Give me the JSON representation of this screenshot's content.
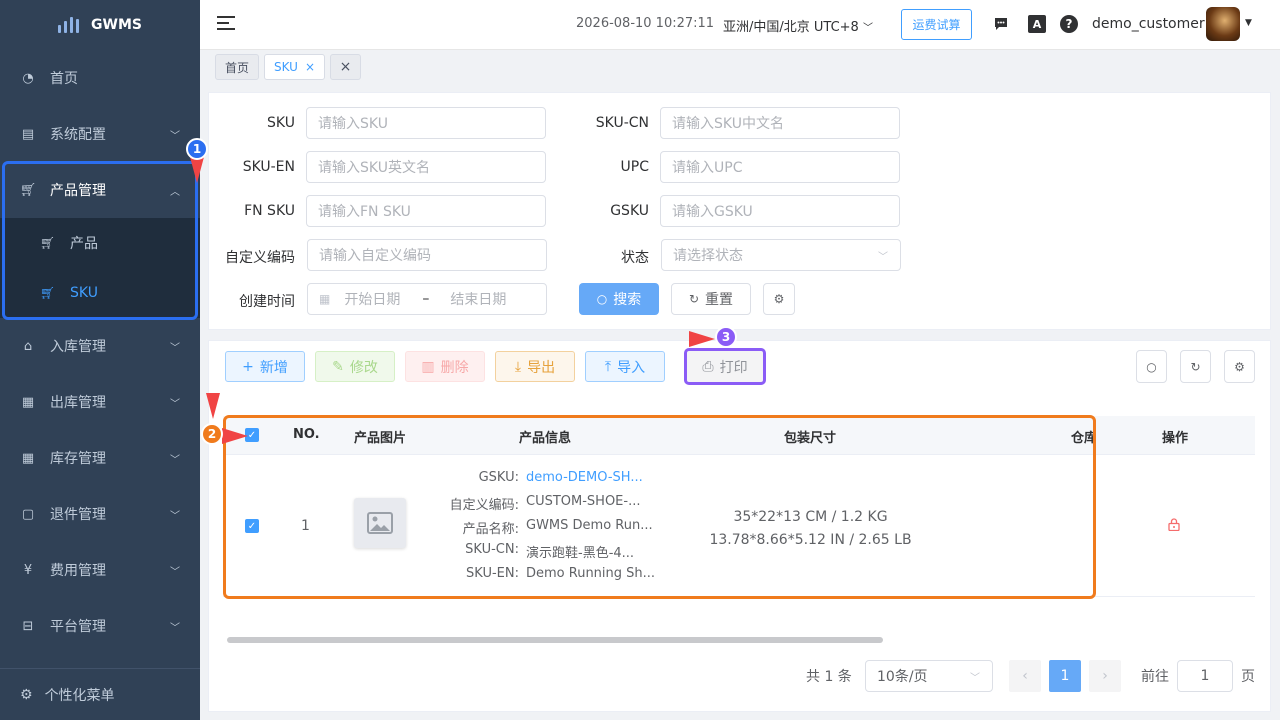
{
  "app": {
    "name": "GWMS"
  },
  "sidebar": {
    "items": [
      {
        "label": "首页",
        "icon": "dashboard-icon"
      },
      {
        "label": "系统配置",
        "icon": "system-config-icon"
      },
      {
        "label": "产品管理",
        "icon": "cart-icon"
      },
      {
        "label": "入库管理",
        "icon": "inbound-icon"
      },
      {
        "label": "出库管理",
        "icon": "outbound-icon"
      },
      {
        "label": "库存管理",
        "icon": "inventory-icon"
      },
      {
        "label": "退件管理",
        "icon": "returns-icon"
      },
      {
        "label": "费用管理",
        "icon": "yuan-icon"
      },
      {
        "label": "平台管理",
        "icon": "platform-icon"
      }
    ],
    "sub_items": [
      {
        "label": "产品"
      },
      {
        "label": "SKU"
      }
    ],
    "custom_menu": "个性化菜单"
  },
  "header": {
    "datetime": "2026-08-10 10:27:11",
    "timezone": "亚洲/中国/北京 UTC+8",
    "freight_button": "运费试算",
    "username": "demo_customer"
  },
  "tabs": [
    {
      "label": "首页"
    },
    {
      "label": "SKU"
    },
    {
      "label": ""
    }
  ],
  "filters": {
    "sku": {
      "label": "SKU",
      "placeholder": "请输入SKU"
    },
    "sku_cn": {
      "label": "SKU-CN",
      "placeholder": "请输入SKU中文名"
    },
    "sku_en": {
      "label": "SKU-EN",
      "placeholder": "请输入SKU英文名"
    },
    "upc": {
      "label": "UPC",
      "placeholder": "请输入UPC"
    },
    "fn_sku": {
      "label": "FN SKU",
      "placeholder": "请输入FN SKU"
    },
    "gsku": {
      "label": "GSKU",
      "placeholder": "请输入GSKU"
    },
    "custom_code": {
      "label": "自定义编码",
      "placeholder": "请输入自定义编码"
    },
    "status": {
      "label": "状态",
      "placeholder": "请选择状态"
    },
    "created": {
      "label": "创建时间",
      "start": "开始日期",
      "sep": "–",
      "end": "结束日期"
    },
    "search": "搜索",
    "reset": "重置"
  },
  "toolbar": {
    "add": "新增",
    "edit": "修改",
    "delete": "删除",
    "export": "导出",
    "import": "导入",
    "print": "打印"
  },
  "table": {
    "headers": {
      "no": "NO.",
      "image": "产品图片",
      "info": "产品信息",
      "pack": "包装尺寸",
      "warehouse": "仓库",
      "ops": "操作"
    },
    "rows": [
      {
        "no": "1",
        "gsku_k": "GSKU:",
        "gsku_v": "demo-DEMO-SH...",
        "code_k": "自定义编码:",
        "code_v": "CUSTOM-SHOE-...",
        "name_k": "产品名称:",
        "name_v": "GWMS Demo Run...",
        "cn_k": "SKU-CN:",
        "cn_v": "演示跑鞋-黑色-4...",
        "en_k": "SKU-EN:",
        "en_v": "Demo Running Sh...",
        "pack_metric": "35*22*13 CM / 1.2 KG",
        "pack_imperial": "13.78*8.66*5.12 IN / 2.65 LB"
      }
    ]
  },
  "pagination": {
    "total": "共 1 条",
    "size": "10条/页",
    "page": "1",
    "goto_label": "前往",
    "goto_value": "1",
    "page_suffix": "页"
  },
  "annotations": [
    {
      "label": "1"
    },
    {
      "label": "2"
    },
    {
      "label": "3"
    }
  ],
  "colors": {
    "primary": "#409eff",
    "sidebar": "#304156",
    "annot_blue": "#2b6ef0",
    "annot_orange": "#f07b1d",
    "annot_purple": "#8b5cf6",
    "annot_red": "#f04444"
  }
}
